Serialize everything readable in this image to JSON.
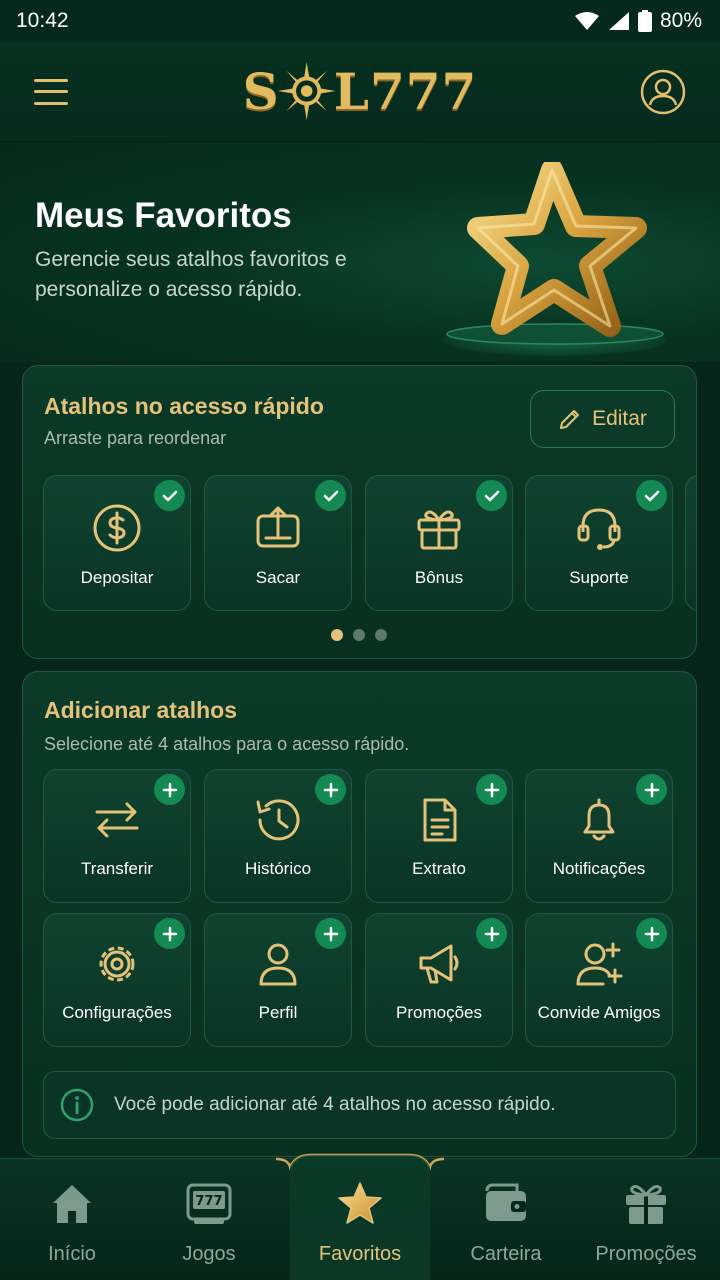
{
  "status_bar": {
    "time": "10:42",
    "battery": "80%"
  },
  "header": {
    "logo_left": "S",
    "logo_right": "L777"
  },
  "hero": {
    "title": "Meus Favoritos",
    "subtitle": "Gerencie seus atalhos favoritos e personalize o acesso rápido."
  },
  "quick_access": {
    "title": "Atalhos no acesso rápido",
    "subtitle": "Arraste para reordenar",
    "edit_label": "Editar",
    "items": [
      {
        "label": "Depositar",
        "icon": "dollar-coin-icon"
      },
      {
        "label": "Sacar",
        "icon": "withdraw-icon"
      },
      {
        "label": "Bônus",
        "icon": "gift-icon"
      },
      {
        "label": "Suporte",
        "icon": "headset-icon"
      }
    ],
    "page_count": 3,
    "active_page": 1
  },
  "add_shortcuts": {
    "title": "Adicionar atalhos",
    "subtitle": "Selecione até 4 atalhos para o acesso rápido.",
    "items": [
      {
        "label": "Transferir",
        "icon": "transfer-arrows-icon"
      },
      {
        "label": "Histórico",
        "icon": "history-clock-icon"
      },
      {
        "label": "Extrato",
        "icon": "document-icon"
      },
      {
        "label": "Notificações",
        "icon": "bell-icon"
      },
      {
        "label": "Configurações",
        "icon": "gear-icon"
      },
      {
        "label": "Perfil",
        "icon": "user-icon"
      },
      {
        "label": "Promoções",
        "icon": "megaphone-icon"
      },
      {
        "label": "Convide Amigos",
        "icon": "add-friend-icon"
      }
    ],
    "info_text": "Você pode adicionar até 4 atalhos no acesso rápido."
  },
  "bottom_nav": {
    "items": [
      {
        "label": "Início",
        "icon": "home-icon"
      },
      {
        "label": "Jogos",
        "icon": "slot-machine-icon"
      },
      {
        "label": "Favoritos",
        "icon": "star-icon"
      },
      {
        "label": "Carteira",
        "icon": "wallet-icon"
      },
      {
        "label": "Promoções",
        "icon": "gift-icon"
      }
    ],
    "active": "Favoritos"
  },
  "colors": {
    "background": "#062419",
    "accent_gold": "#e4c27a",
    "badge_green": "#148a52"
  }
}
